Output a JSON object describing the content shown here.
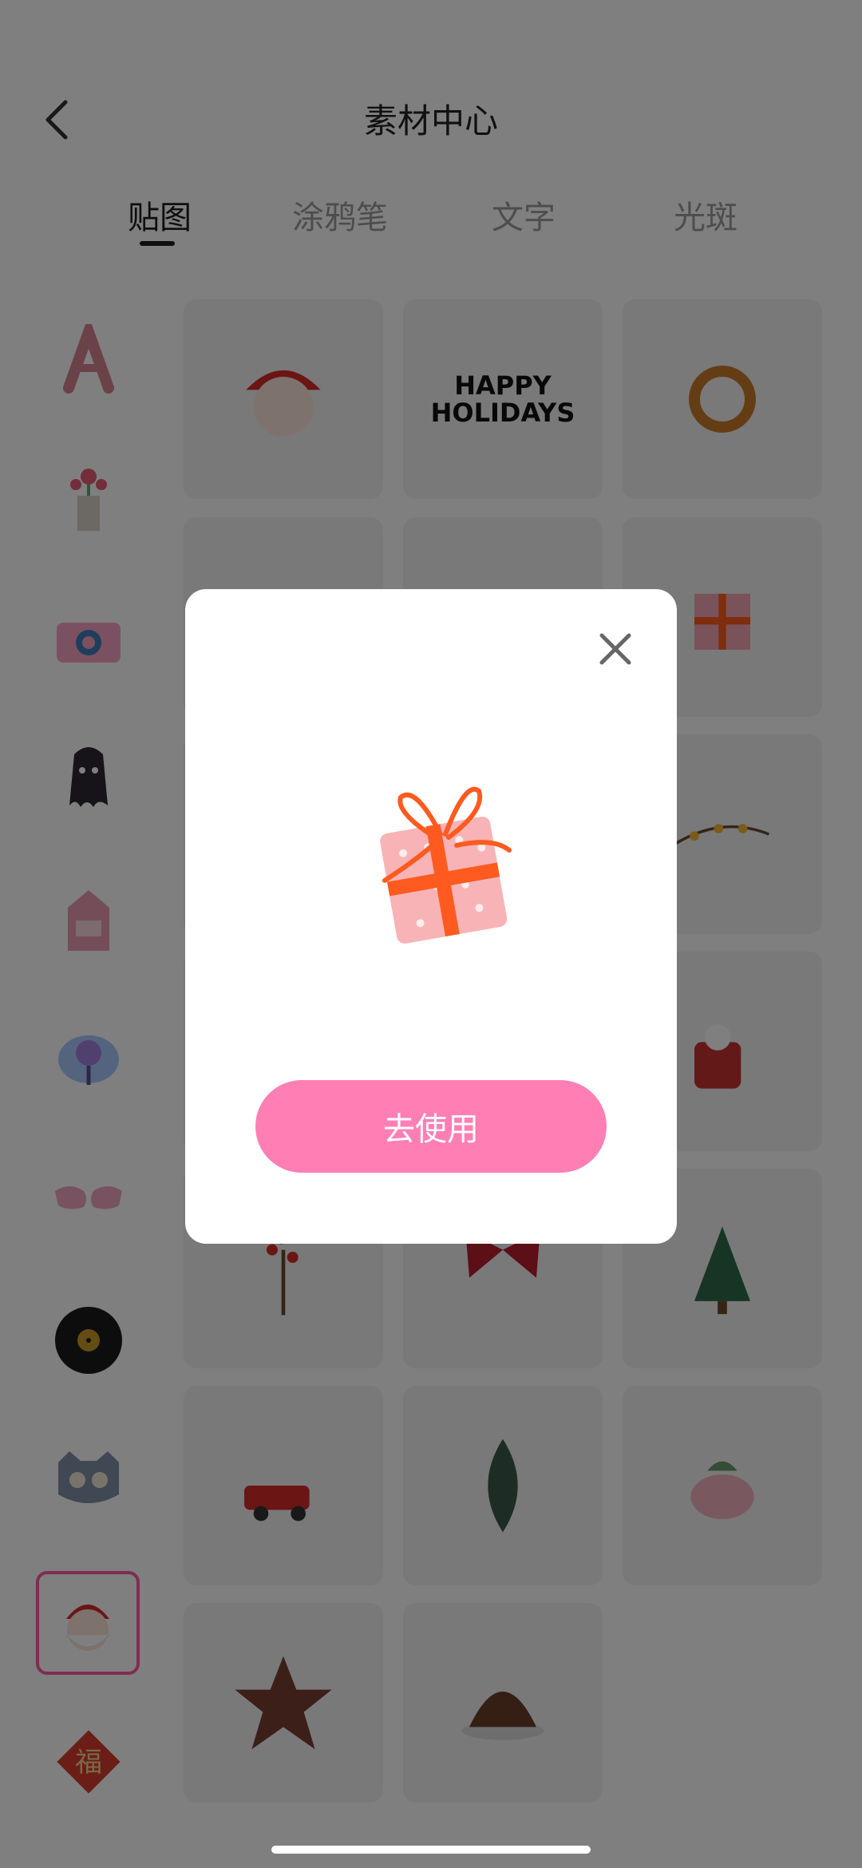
{
  "header": {
    "title": "素材中心"
  },
  "tabs": [
    {
      "label": "贴图"
    },
    {
      "label": "涂鸦笔"
    },
    {
      "label": "文字"
    },
    {
      "label": "光斑"
    }
  ],
  "sidebar": {
    "icons": [
      "letter-a-balloon-icon",
      "flower-vase-icon",
      "camera-icon",
      "ghost-bat-icon",
      "milk-carton-icon",
      "lollipop-badge-icon",
      "sunglasses-icon",
      "vinyl-record-icon",
      "cat-face-icon",
      "santa-face-icon",
      "fu-character-icon"
    ],
    "selected_index": 9,
    "fu_text": "福"
  },
  "grid": {
    "row1": [
      "santa-face",
      "happy-holidays-text",
      "pretzel"
    ],
    "visible_others": [
      "gift-box",
      "string-lights",
      "cocoa-mug",
      "berry-branch",
      "red-bow",
      "christmas-tree",
      "red-truck",
      "holly-leaf",
      "bird-with-hat",
      "gingerbread-star",
      "plum-pudding"
    ],
    "happy_holidays_text": "HAPPY HOLIDAYS"
  },
  "modal": {
    "hero_icon": "gift-box-icon",
    "cta_label": "去使用",
    "close_icon": "close-icon"
  },
  "colors": {
    "accent_pink": "#ff7fb5",
    "overlay": "rgba(0,0,0,0.5)"
  }
}
